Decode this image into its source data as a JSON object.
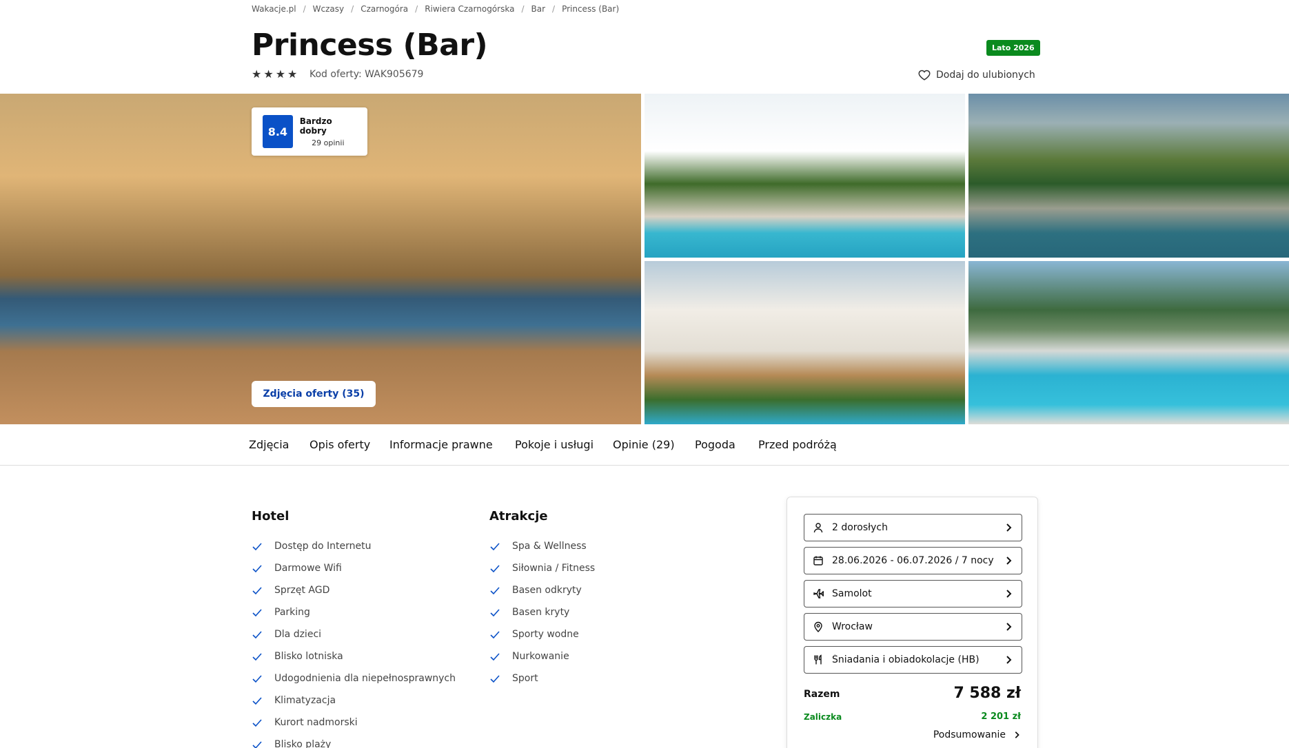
{
  "breadcrumb": [
    "Wakacje.pl",
    "Wczasy",
    "Czarnogóra",
    "Riwiera Czarnogórska",
    "Bar",
    "Princess (Bar)"
  ],
  "title": "Princess (Bar)",
  "stars": 4,
  "offer_code": "Kod oferty: WAK905679",
  "season_badge": "Lato 2026",
  "favorite_label": "Dodaj do ulubionych",
  "rating": {
    "score": "8.4",
    "label": "Bardzo dobry",
    "count": "29 opinii"
  },
  "photos_button": "Zdjęcia oferty (35)",
  "tabs": [
    "Zdjęcia",
    "Opis oferty",
    "Informacje prawne",
    "Pokoje i usługi",
    "Opinie (29)",
    "Pogoda",
    "Przed podróżą"
  ],
  "hotel": {
    "title": "Hotel",
    "items": [
      "Dostęp do Internetu",
      "Darmowe Wifi",
      "Sprzęt AGD",
      "Parking",
      "Dla dzieci",
      "Blisko lotniska",
      "Udogodnienia dla niepełnosprawnych",
      "Klimatyzacja",
      "Kurort nadmorski",
      "Blisko plaży"
    ]
  },
  "attractions": {
    "title": "Atrakcje",
    "items": [
      "Spa & Wellness",
      "Siłownia / Fitness",
      "Basen odkryty",
      "Basen kryty",
      "Sporty wodne",
      "Nurkowanie",
      "Sport"
    ]
  },
  "booking": {
    "guests": "2 dorosłych",
    "dates": "28.06.2026 - 06.07.2026 / 7 nocy",
    "transport": "Samolot",
    "departure": "Wrocław",
    "board": "Śniadania i obiadokolacje (HB)",
    "total_label": "Razem",
    "total_price": "7 588 zł",
    "deposit_label": "Zaliczka",
    "deposit_price": "2 201 zł",
    "summary_label": "Podsumowanie"
  },
  "colors": {
    "rating_blue": "#0a51c7",
    "badge_green": "#0a8a1e",
    "link_blue": "#0a3fa8"
  }
}
